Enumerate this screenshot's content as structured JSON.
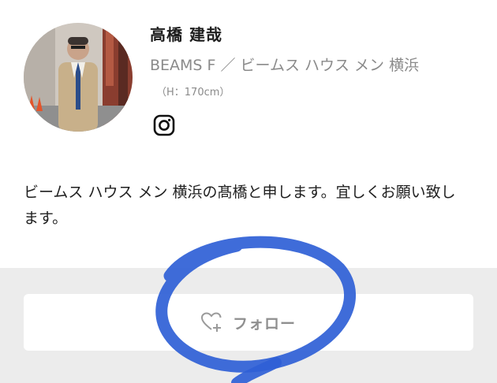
{
  "profile": {
    "name": "高橋 建哉",
    "shop": "BEAMS F ／ ビームス ハウス メン 横浜",
    "height": "（H：170cm）",
    "bio": "ビームス ハウス メン 横浜の髙橋と申します。宜しくお願い致します。"
  },
  "icons": {
    "social": "instagram-icon",
    "follow": "heart-plus-icon"
  },
  "follow_button": {
    "label": "フォロー"
  },
  "colors": {
    "annotation": "#2f5fd6",
    "bottom_bg": "#ececec",
    "muted_text": "#8a8a8a"
  }
}
